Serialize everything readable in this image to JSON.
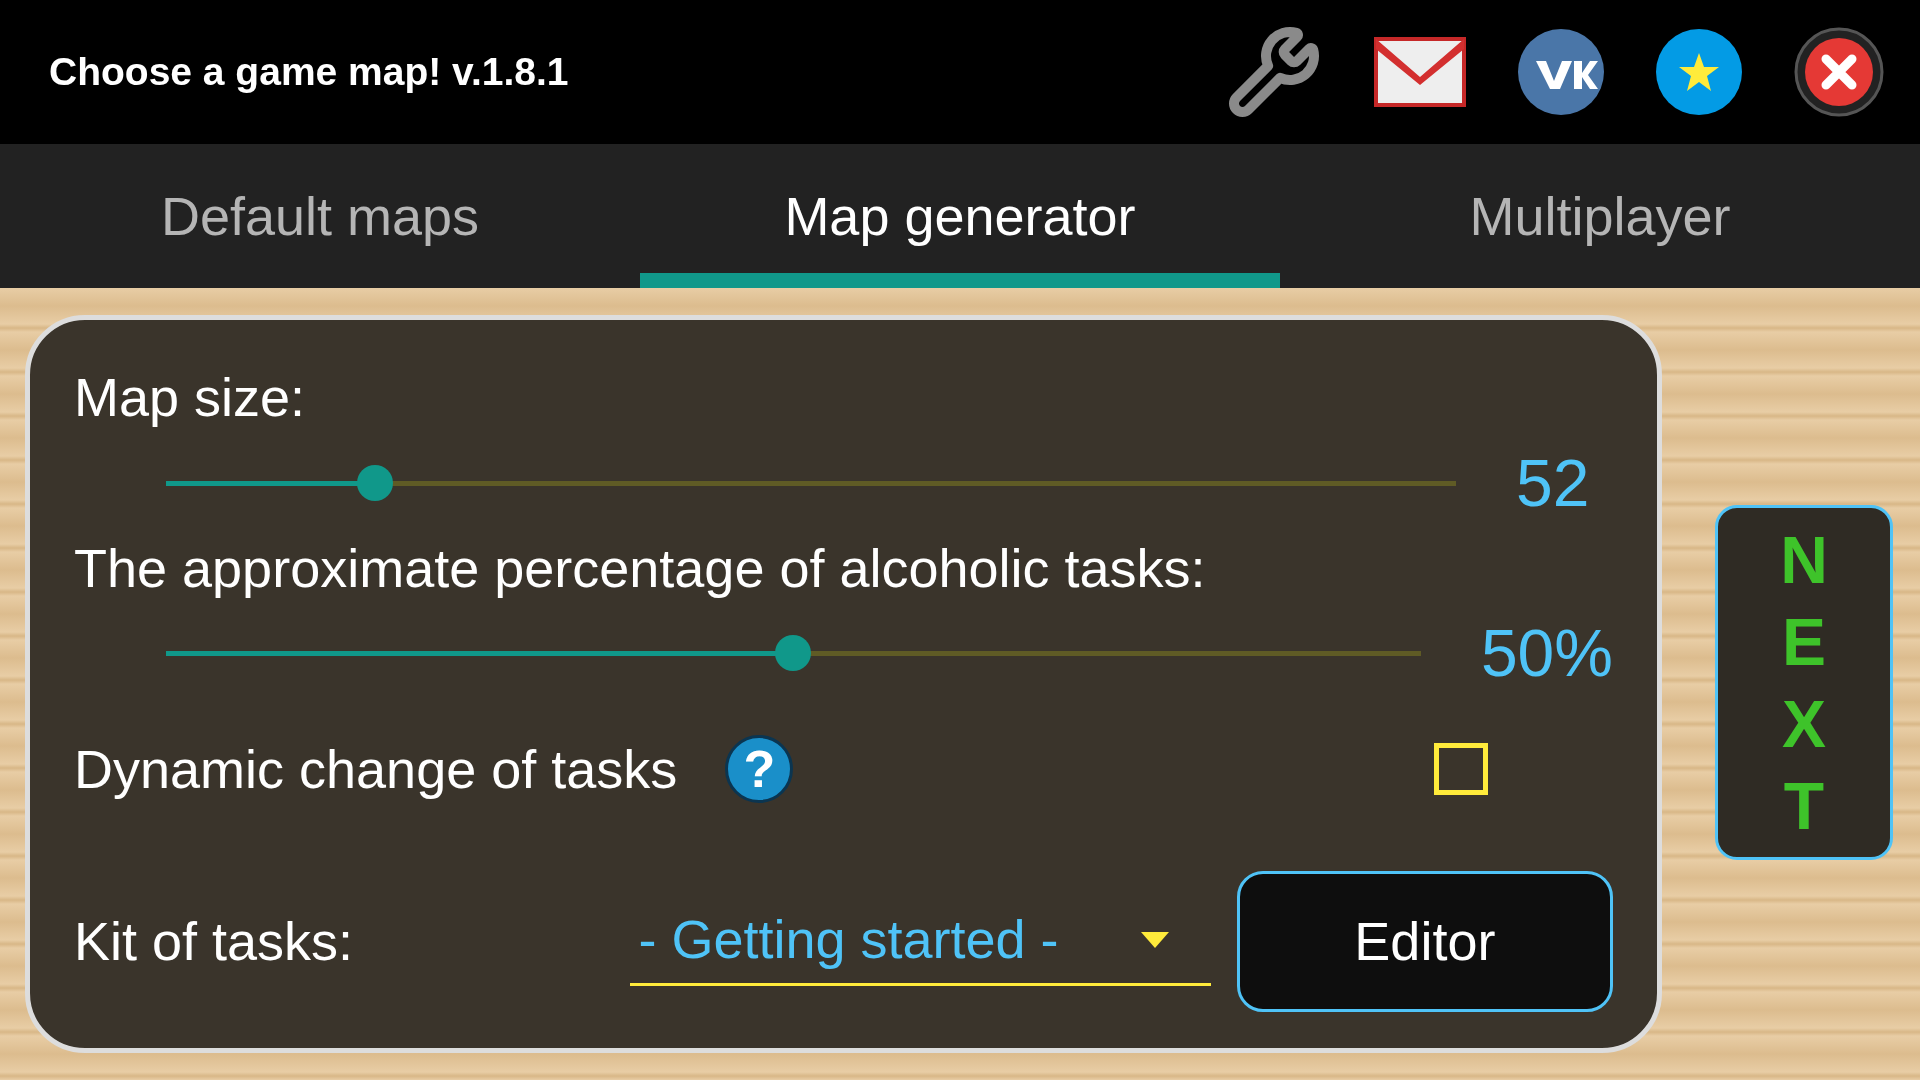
{
  "header": {
    "title": "Choose a game map! v.1.8.1"
  },
  "tabs": [
    {
      "label": "Default maps",
      "selected": false
    },
    {
      "label": "Map generator",
      "selected": true
    },
    {
      "label": "Multiplayer",
      "selected": false
    }
  ],
  "settings": {
    "map_size": {
      "label": "Map size:",
      "level": 0.162,
      "reading": "52"
    },
    "alcohol": {
      "label": "The approximate percentage of alcoholic tasks:",
      "level": 0.5,
      "reading": "50%"
    },
    "dynamic": {
      "label": "Dynamic change of tasks",
      "help": "?",
      "checked": false
    },
    "kit": {
      "label": "Kit of tasks:",
      "value": "- Getting started -"
    },
    "editor_button": "Editor"
  },
  "next_button": [
    "N",
    "E",
    "X",
    "T"
  ]
}
